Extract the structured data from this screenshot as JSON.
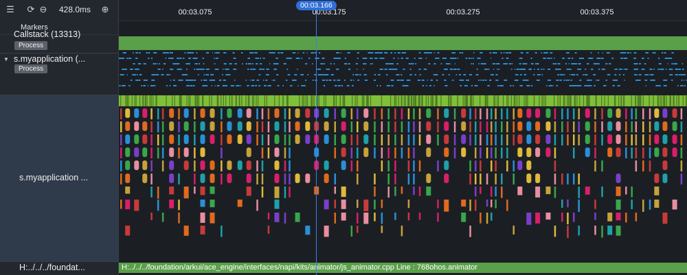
{
  "toolbar": {
    "zoom_level": "428.0ms",
    "icons": [
      "list-icon",
      "refresh-icon",
      "zoom-out-icon",
      "zoom-in-icon"
    ]
  },
  "left_panel": {
    "markers_label": "Markers",
    "rows": [
      {
        "title": "Callstack (13313)",
        "tag": "Process"
      },
      {
        "title": "s.myapplication (...",
        "tag": "Process"
      }
    ],
    "big_row_title": "s.myapplication ...",
    "bottom_row_title": "H:../../../foundat..."
  },
  "timeline": {
    "ticks": [
      "00:03.075",
      "00:03.175",
      "00:03.275",
      "00:03.375"
    ],
    "cursor_time": "00:03.166",
    "bottom_event_text": "H:../../../foundation/arkui/ace_engine/interfaces/napi/kits/animator/js_animator.cpp Line : 768ohos.animator"
  },
  "colors": {
    "green": "#5aa04a",
    "cursor": "#3d7df0",
    "event_blue": "#2a8fd6"
  }
}
